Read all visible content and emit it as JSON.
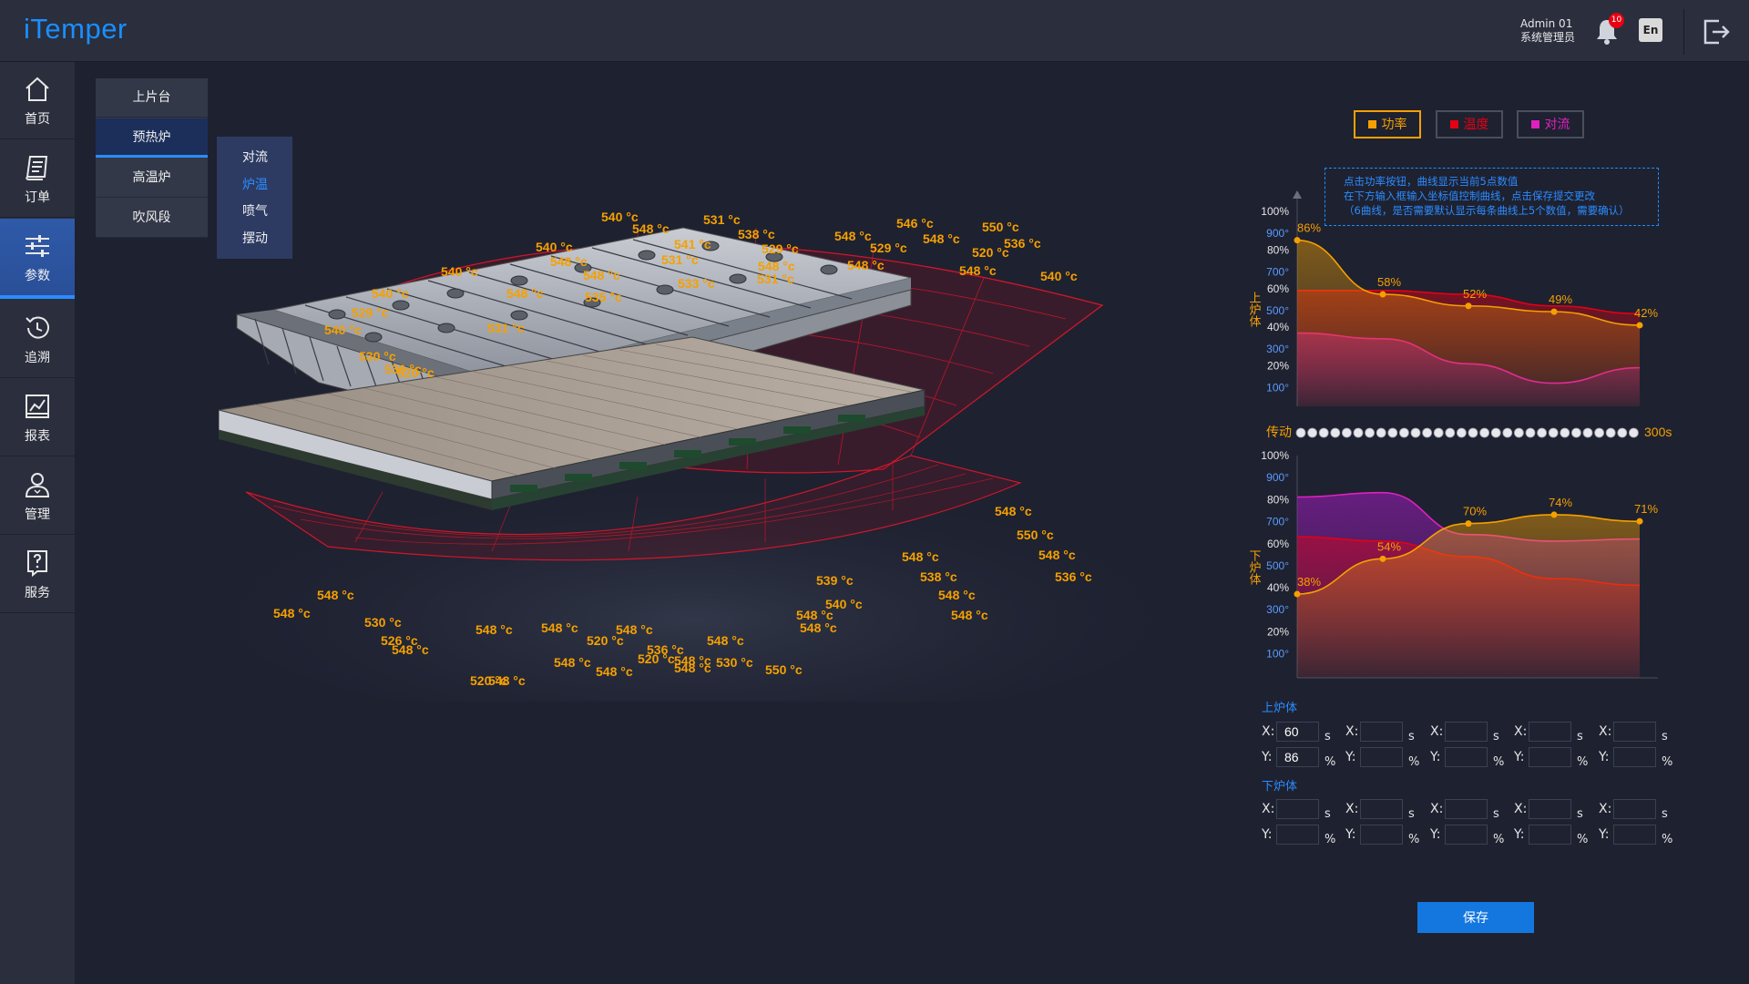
{
  "app": {
    "title": "iTemper"
  },
  "user": {
    "name": "Admin 01",
    "role": "系统管理员",
    "notification_count": "10",
    "lang_label": "En"
  },
  "sidebar": {
    "items": [
      {
        "label": "首页",
        "icon": "home-icon"
      },
      {
        "label": "订单",
        "icon": "order-icon"
      },
      {
        "label": "参数",
        "icon": "sliders-icon",
        "active": true
      },
      {
        "label": "追溯",
        "icon": "history-icon"
      },
      {
        "label": "报表",
        "icon": "chart-icon"
      },
      {
        "label": "管理",
        "icon": "user-icon"
      },
      {
        "label": "服务",
        "icon": "help-icon"
      }
    ]
  },
  "submenu": {
    "items": [
      "上片台",
      "预热炉",
      "高温炉",
      "吹风段"
    ],
    "active": "预热炉",
    "children": [
      "对流",
      "炉温",
      "喷气",
      "摆动"
    ],
    "active_child": "炉温"
  },
  "scene": {
    "upper_labels": [
      "540 °c",
      "531 °c",
      "546 °c",
      "550 °c",
      "548 °c",
      "538 °c",
      "548 °c",
      "548 °c",
      "536 °c",
      "540 °c",
      "541 °c",
      "529 °c",
      "529 °c",
      "520 °c",
      "548 °c",
      "531 °c",
      "548 °c",
      "548 °c",
      "548 °c",
      "540 °c",
      "540 °c",
      "548 °c",
      "533 °c",
      "531 °c",
      "540 °c",
      "548 °c",
      "535 °c",
      "529 °c",
      "540 °c",
      "531 °c",
      "530 °c",
      "520 °c",
      "530 °c"
    ],
    "lower_labels": [
      "548 °c",
      "550 °c",
      "548 °c",
      "536 °c",
      "548 °c",
      "538 °c",
      "548 °c",
      "548 °c",
      "539 °c",
      "540 °c",
      "548 °c",
      "548 °c",
      "548 °c",
      "536 °c",
      "520 °c",
      "548 °c",
      "520 °c",
      "530 °c",
      "530 °c",
      "548 °c",
      "526 °c",
      "548 °c",
      "548 °c",
      "548 °c",
      "548 °c",
      "548 °c",
      "520 °c",
      "548 °c",
      "548 °c",
      "548 °c",
      "548 °c",
      "550 °c"
    ]
  },
  "legend": {
    "buttons": [
      {
        "label": "功率",
        "color": "#f5a000"
      },
      {
        "label": "温度",
        "color": "#e60012"
      },
      {
        "label": "对流",
        "color": "#e020c0"
      }
    ],
    "tip_lines": [
      "点击功率按钮，曲线显示当前5点数值",
      "在下方输入框输入坐标值控制曲线，点击保存提交更改",
      "（6曲线，是否需要默认显示每条曲线上5个数值，需要确认）"
    ]
  },
  "chart_data": [
    {
      "type": "area",
      "title": "上炉体",
      "ylabel": "上炉体",
      "y_ticks_percent": [
        "100%",
        "80%",
        "60%",
        "40%",
        "20%"
      ],
      "y_ticks_temp": [
        "900°",
        "700°",
        "500°",
        "300°",
        "100°"
      ],
      "series": [
        {
          "name": "功率",
          "color": "#f5a000",
          "labels": [
            "86%",
            "58%",
            "52%",
            "49%",
            "42%"
          ],
          "values": [
            86,
            58,
            52,
            49,
            42
          ]
        },
        {
          "name": "温度",
          "color": "#e60012",
          "values": [
            0.6,
            0.6,
            0.58,
            0.52,
            0.48
          ]
        },
        {
          "name": "对流",
          "color": "#e020c0",
          "values": [
            0.38,
            0.35,
            0.22,
            0.12,
            0.2
          ]
        }
      ]
    },
    {
      "type": "area",
      "title": "下炉体",
      "ylabel": "下炉体",
      "y_ticks_percent": [
        "100%",
        "80%",
        "60%",
        "40%",
        "20%"
      ],
      "y_ticks_temp": [
        "900°",
        "700°",
        "500°",
        "300°",
        "100°"
      ],
      "series": [
        {
          "name": "功率",
          "color": "#f5a000",
          "labels": [
            "38%",
            "54%",
            "70%",
            "74%",
            "71%"
          ],
          "values": [
            38,
            54,
            70,
            74,
            71
          ]
        },
        {
          "name": "温度",
          "color": "#e60012",
          "values": [
            0.64,
            0.62,
            0.55,
            0.45,
            0.42
          ]
        },
        {
          "name": "对流",
          "color": "#e020c0",
          "values": [
            0.82,
            0.84,
            0.65,
            0.62,
            0.63
          ]
        }
      ]
    }
  ],
  "transmission": {
    "label": "传动",
    "time": "300s"
  },
  "form": {
    "upper_title": "上炉体",
    "lower_title": "下炉体",
    "x_label": "X:",
    "y_label": "Y:",
    "x_unit": "s",
    "y_unit": "%",
    "upper_x": [
      "60",
      "",
      "",
      "",
      ""
    ],
    "upper_y": [
      "86",
      "",
      "",
      "",
      ""
    ],
    "lower_x": [
      "",
      "",
      "",
      "",
      ""
    ],
    "lower_y": [
      "",
      "",
      "",
      "",
      ""
    ],
    "save_label": "保存"
  }
}
